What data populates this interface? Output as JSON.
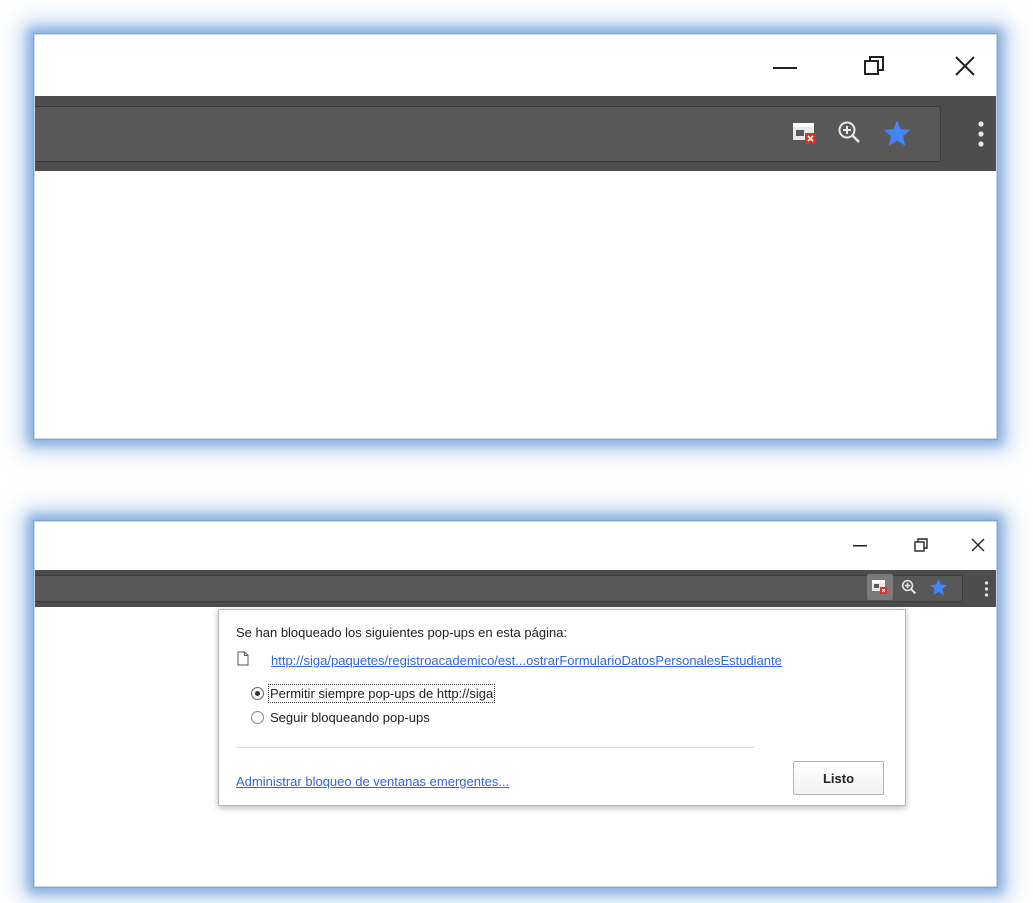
{
  "browser": {
    "accent_color": "#4285f4",
    "blocked_badge_color": "#d93025",
    "toolbar_color": "#4d4d4d",
    "window_controls": [
      "minimize-icon",
      "restore-icon",
      "close-icon"
    ],
    "toolbar_icons": [
      "popup-blocked-icon",
      "zoom-in-icon",
      "bookmark-star-icon",
      "kebab-menu-icon"
    ]
  },
  "popup_bubble": {
    "title": "Se han bloqueado los siguientes pop-ups en esta página:",
    "popup_link": "http://siga/paquetes/registroacademico/est...ostrarFormularioDatosPersonalesEstudiante",
    "options": [
      {
        "label": "Permitir siempre pop-ups de http://siga",
        "checked": true
      },
      {
        "label": "Seguir bloqueando pop-ups",
        "checked": false
      }
    ],
    "manage_link": "Administrar bloqueo de ventanas emergentes...",
    "done_button": "Listo"
  }
}
